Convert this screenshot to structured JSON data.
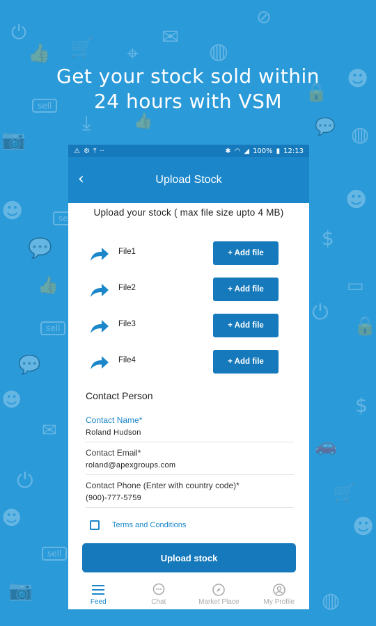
{
  "headline": {
    "line1": "Get your stock sold within",
    "line2": "24 hours with VSM"
  },
  "background": {
    "sell_tag": "sell"
  },
  "status_bar": {
    "battery": "100%",
    "time": "12:13"
  },
  "app_bar": {
    "title": "Upload Stock",
    "back_icon": "chevron-left-icon"
  },
  "upload": {
    "hint": "Upload your stock ( max file size upto 4 MB)",
    "files": [
      {
        "label": "File1",
        "button": "+ Add file"
      },
      {
        "label": "File2",
        "button": "+ Add file"
      },
      {
        "label": "File3",
        "button": "+ Add file"
      },
      {
        "label": "File4",
        "button": "+ Add file"
      }
    ]
  },
  "contact": {
    "title": "Contact Person",
    "name_label": "Contact Name*",
    "name_value": "Roland Hudson",
    "email_label": "Contact Email*",
    "email_value": "roland@apexgroups.com",
    "phone_label": "Contact Phone (Enter with country code)*",
    "phone_value": "(900)-777-5759"
  },
  "terms": {
    "label": "Terms and Conditions"
  },
  "submit": {
    "label": "Upload stock"
  },
  "nav": {
    "items": [
      {
        "label": "Feed",
        "icon": "menu-icon"
      },
      {
        "label": "Chat",
        "icon": "chat-icon"
      },
      {
        "label": "Market Place",
        "icon": "compass-icon"
      },
      {
        "label": "My Profile",
        "icon": "profile-icon"
      }
    ]
  },
  "colors": {
    "background": "#2b9ad9",
    "primary": "#1b87ca",
    "button": "#1579bb"
  }
}
